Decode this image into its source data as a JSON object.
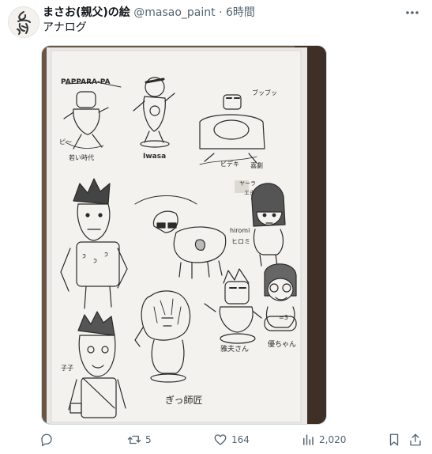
{
  "author": {
    "display_name": "まさお(親父)の絵",
    "handle": "@masao_paint",
    "separator": "·",
    "time_ago": "6時間"
  },
  "tweet": {
    "text": "アナログ"
  },
  "media": {
    "caption_bottom": "ぎっ師匠",
    "sketch_labels": [
      "PAPPARA-PA",
      "ピ〜",
      "若い時代",
      "Iwasa",
      "ブッブッ",
      "ビデキ",
      "喜劇",
      "hiromi",
      "ヒロミ",
      "ヤーラ",
      "エぎ",
      "雅夫さん",
      "優ちゃん",
      "子子",
      "=3"
    ]
  },
  "actions": {
    "reply": {
      "icon": "reply-icon",
      "count": ""
    },
    "retweet": {
      "icon": "retweet-icon",
      "count": "5"
    },
    "like": {
      "icon": "heart-icon",
      "count": "164"
    },
    "views": {
      "icon": "views-icon",
      "count": "2,020"
    },
    "bookmark": {
      "icon": "bookmark-icon"
    },
    "share": {
      "icon": "share-icon"
    }
  },
  "colors": {
    "text_primary": "#0f1419",
    "text_secondary": "#536471",
    "border": "#cfd9de"
  }
}
